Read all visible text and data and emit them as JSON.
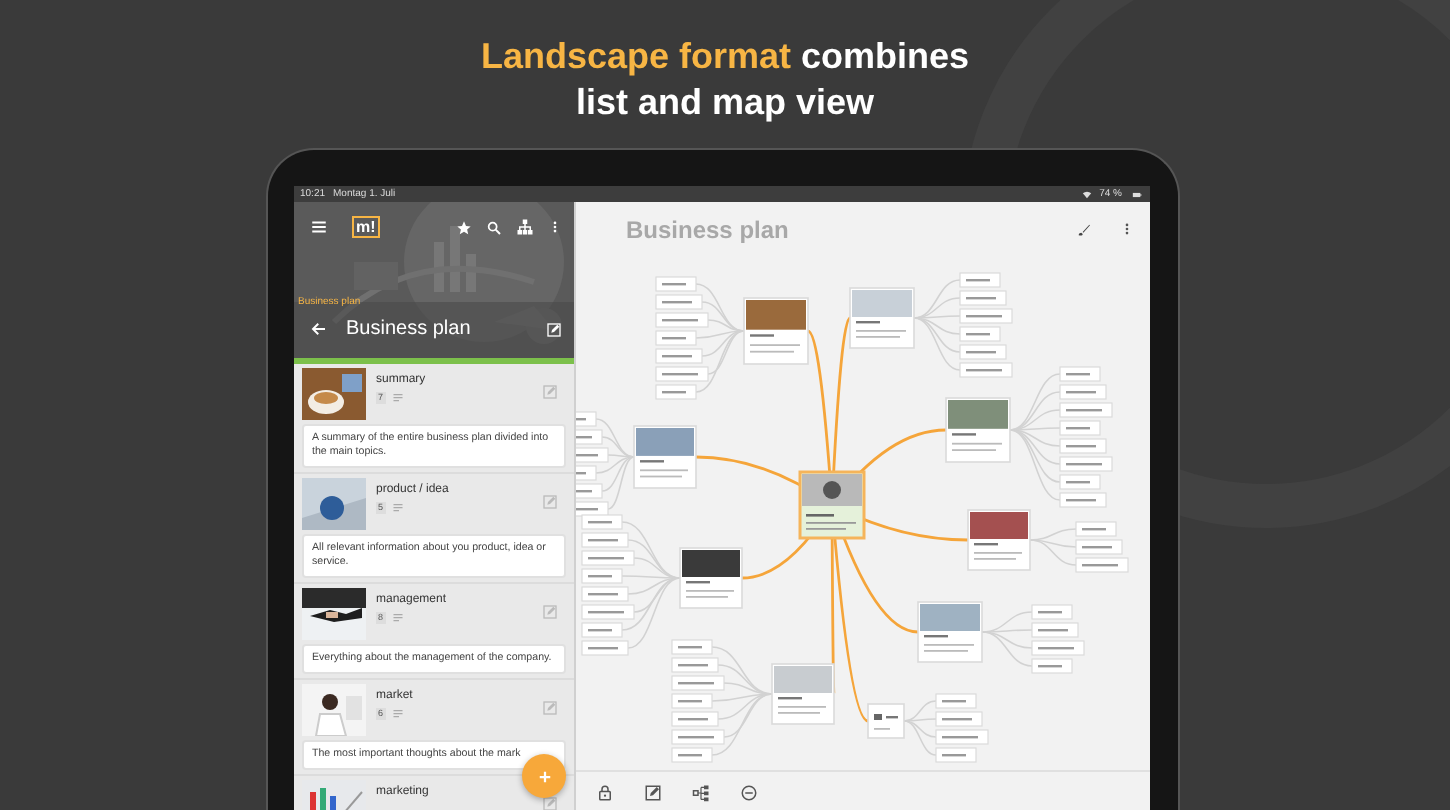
{
  "headline": {
    "lines": [
      [
        {
          "text": "Landscape format",
          "highlight": true
        },
        {
          "text": " combines",
          "highlight": false
        }
      ],
      [
        {
          "text": "list and map view",
          "highlight": false
        }
      ]
    ]
  },
  "status_bar": {
    "time": "10:21",
    "date": "Montag 1. Juli",
    "battery": "74 %"
  },
  "sidebar": {
    "logo": "m!",
    "breadcrumb": "Business plan",
    "title": "Business plan",
    "items": [
      {
        "title": "summary",
        "count": "7",
        "description": "A summary of the entire business plan divided into the main topics."
      },
      {
        "title": "product / idea",
        "count": "5",
        "description": "All relevant information about you product, idea or service."
      },
      {
        "title": "management",
        "count": "8",
        "description": "Everything about the management of the company."
      },
      {
        "title": "market",
        "count": "6",
        "description": "The most important thoughts about the mark"
      },
      {
        "title": "marketing"
      }
    ]
  },
  "map": {
    "title": "Business plan"
  }
}
